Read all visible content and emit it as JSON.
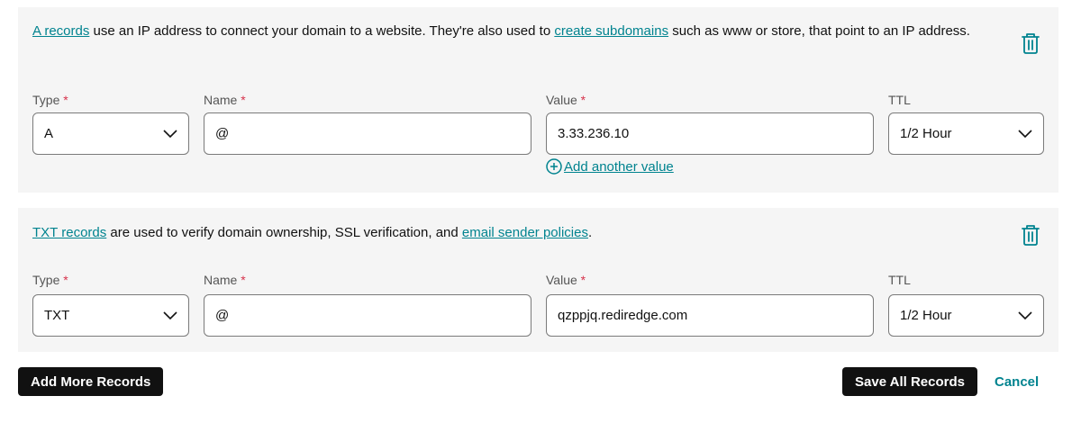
{
  "a_record": {
    "desc_link1": "A records",
    "desc_text1": " use an IP address to connect your domain to a website. They're also used to ",
    "desc_link2": "create subdomains",
    "desc_text2": " such as www or store, that point to an IP address.",
    "type_label": "Type",
    "name_label": "Name",
    "value_label": "Value",
    "ttl_label": "TTL",
    "required_mark": "*",
    "type_value": "A",
    "name_value": "@",
    "value_value": "3.33.236.10",
    "ttl_value": "1/2 Hour",
    "add_value_label": "Add another value",
    "delete_icon": "trash-icon"
  },
  "txt_record": {
    "desc_link1": "TXT records",
    "desc_text1": " are used to verify domain ownership, SSL verification, and ",
    "desc_link2": "email sender policies",
    "desc_text2": ".",
    "type_label": "Type",
    "name_label": "Name",
    "value_label": "Value",
    "ttl_label": "TTL",
    "required_mark": "*",
    "type_value": "TXT",
    "name_value": "@",
    "value_value": "qzppjq.rediredge.com",
    "ttl_value": "1/2 Hour",
    "delete_icon": "trash-icon"
  },
  "actions": {
    "add_more": "Add More Records",
    "save_all": "Save All Records",
    "cancel": "Cancel"
  },
  "colors": {
    "accent": "#00838f",
    "required": "#d6324b",
    "card_bg": "#f5f5f5",
    "button_dark": "#111111"
  }
}
